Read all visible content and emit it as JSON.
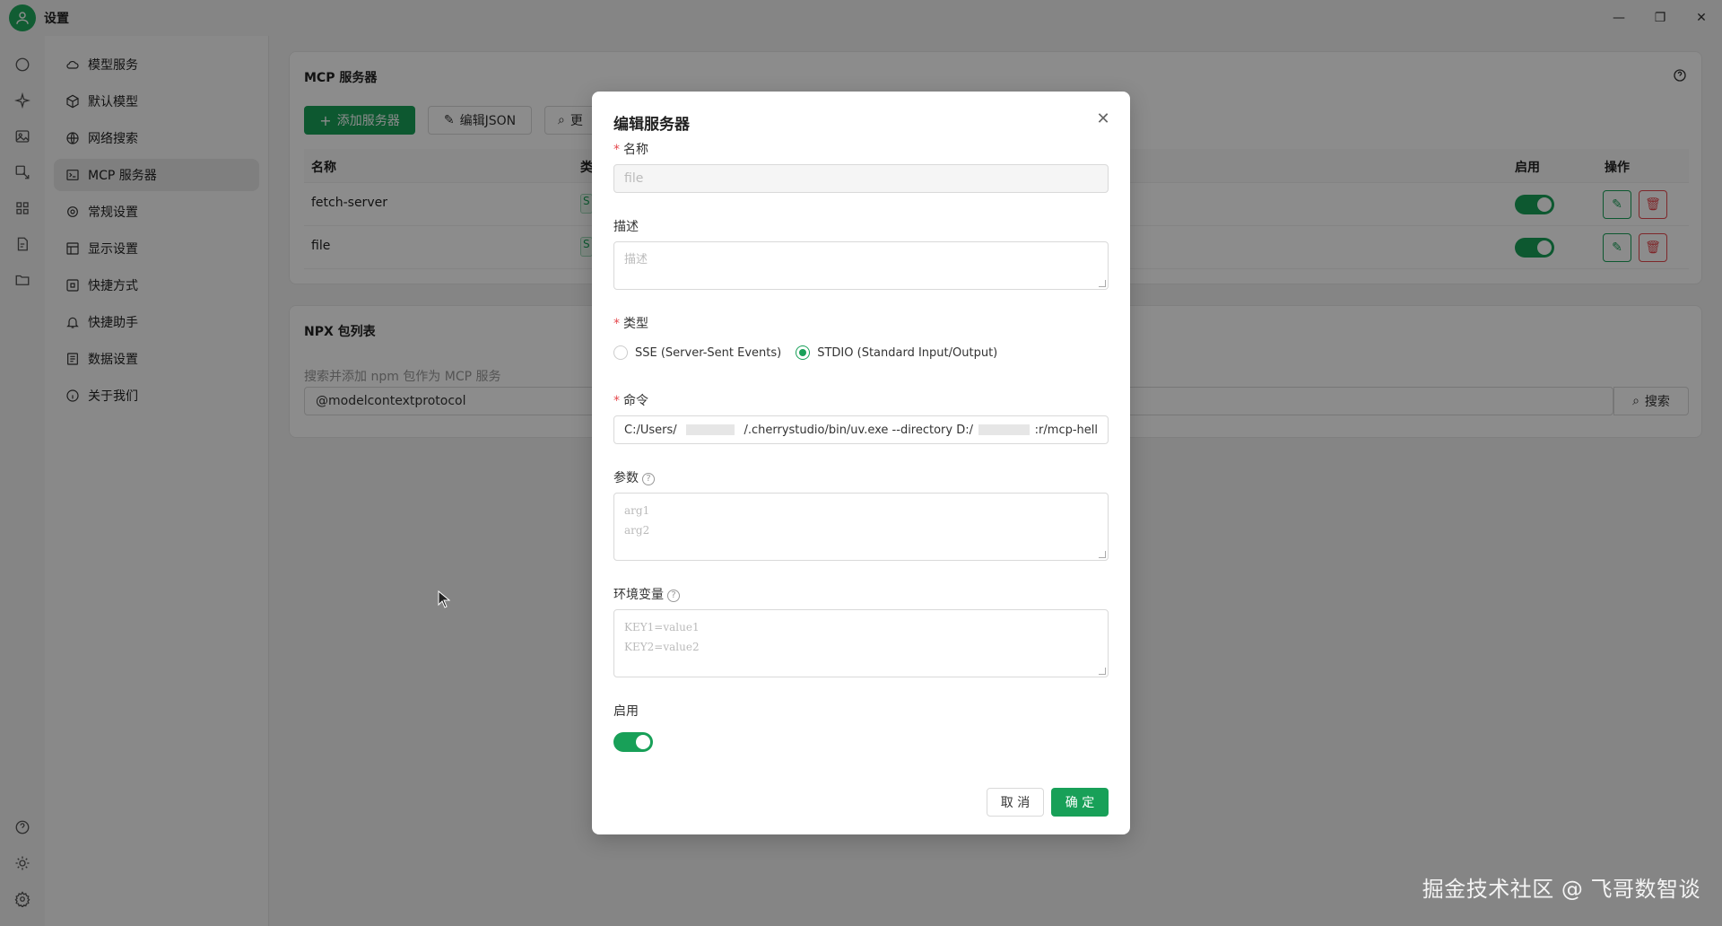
{
  "app": {
    "title": "设置"
  },
  "window_controls": {
    "minimize": "—",
    "restore": "❐",
    "close": "✕"
  },
  "rail": {
    "items": [
      "chat-icon",
      "sparkle-icon",
      "image-icon",
      "translate-icon",
      "apps-icon",
      "notes-icon",
      "folder-icon"
    ],
    "bottom": [
      "help-icon",
      "theme-sun-icon",
      "settings-gear-icon"
    ]
  },
  "sidebar": {
    "items": [
      {
        "label": "模型服务",
        "icon": "cloud-icon",
        "active": false
      },
      {
        "label": "默认模型",
        "icon": "cube-icon",
        "active": false
      },
      {
        "label": "网络搜索",
        "icon": "globe-icon",
        "active": false
      },
      {
        "label": "MCP 服务器",
        "icon": "terminal-icon",
        "active": true
      },
      {
        "label": "常规设置",
        "icon": "gear-icon",
        "active": false
      },
      {
        "label": "显示设置",
        "icon": "layout-icon",
        "active": false
      },
      {
        "label": "快捷方式",
        "icon": "command-icon",
        "active": false
      },
      {
        "label": "快捷助手",
        "icon": "bell-icon",
        "active": false
      },
      {
        "label": "数据设置",
        "icon": "database-icon",
        "active": false
      },
      {
        "label": "关于我们",
        "icon": "info-icon",
        "active": false
      }
    ]
  },
  "mcp": {
    "title": "MCP 服务器",
    "add_button": "添加服务器",
    "edit_json_button": "编辑JSON",
    "more_button": "更",
    "columns": {
      "name": "名称",
      "type": "类",
      "enabled": "启用",
      "actions": "操作"
    },
    "rows": [
      {
        "name": "fetch-server",
        "type": "S",
        "enabled": true
      },
      {
        "name": "file",
        "type": "S",
        "enabled": true
      }
    ]
  },
  "npx": {
    "title": "NPX 包列表",
    "description": "搜索并添加 npm 包作为 MCP 服务",
    "search_value": "@modelcontextprotocol",
    "search_button": "搜索"
  },
  "modal": {
    "title": "编辑服务器",
    "close": "✕",
    "name_label": "名称",
    "name_value": "file",
    "desc_label": "描述",
    "desc_placeholder": "描述",
    "type_label": "类型",
    "type_options": [
      {
        "label": "SSE (Server-Sent Events)",
        "checked": false
      },
      {
        "label": "STDIO (Standard Input/Output)",
        "checked": true
      }
    ],
    "command_label": "命令",
    "command_part1": "C:/Users/",
    "command_part2": "/.cherrystudio/bin/uv.exe --directory D:/",
    "command_part3": ":r/mcp-hell",
    "args_label": "参数",
    "args_placeholder_1": "arg1",
    "args_placeholder_2": "arg2",
    "env_label": "环境变量",
    "env_placeholder_1": "KEY1=value1",
    "env_placeholder_2": "KEY2=value2",
    "enable_label": "启用",
    "enabled": true,
    "cancel_button": "取 消",
    "ok_button": "确 定"
  },
  "watermark": "掘金技术社区 @ 飞哥数智谈",
  "colors": {
    "primary": "#18a058",
    "danger": "#e5484d",
    "mask": "rgba(0,0,0,0.45)"
  }
}
